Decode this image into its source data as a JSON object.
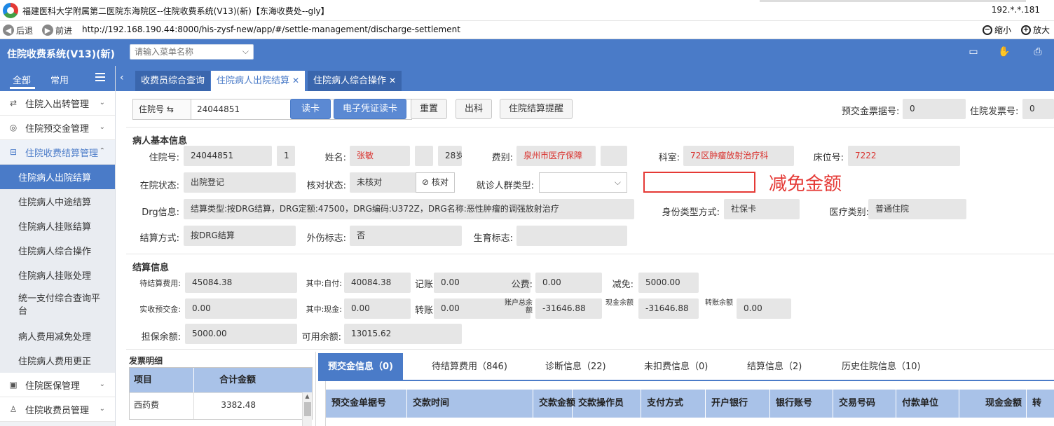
{
  "browser": {
    "title": "福建医科大学附属第二医院东海院区--住院收费系统(V13)(新)【东海收费处--gly】",
    "ip": "192.*.*.181",
    "back_label": "后退",
    "forward_label": "前进",
    "url": "http://192.168.190.44:8000/his-zysf-new/app/#/settle-management/discharge-settlement",
    "zoom_out_label": "缩小",
    "zoom_in_label": "放大"
  },
  "header": {
    "app_title": "住院收费系统(V13)(新)",
    "menu_search_placeholder": "请输入菜单名称",
    "icons": [
      "id-card-icon",
      "hand-icon",
      "print-icon"
    ]
  },
  "sidebar": {
    "tab_all": "全部",
    "tab_common": "常用",
    "groups_top": [
      {
        "label": "住院入出转管理",
        "icon": "transfer-icon"
      },
      {
        "label": "住院预交金管理",
        "icon": "deposit-icon"
      }
    ],
    "open_group": {
      "label": "住院收费结算管理",
      "icon": "settle-icon"
    },
    "items": [
      {
        "label": "住院病人出院结算",
        "active": true
      },
      {
        "label": "住院病人中途结算"
      },
      {
        "label": "住院病人挂账结算"
      },
      {
        "label": "住院病人综合操作"
      },
      {
        "label": "住院病人挂账处理"
      },
      {
        "label": "统一支付综合查询平台"
      },
      {
        "label": "病人费用减免处理"
      },
      {
        "label": "住院病人费用更正"
      }
    ],
    "groups_bottom": [
      {
        "label": "住院医保管理",
        "icon": "insurance-icon"
      },
      {
        "label": "住院收费员管理",
        "icon": "user-icon"
      }
    ]
  },
  "tabs": [
    {
      "label": "收费员综合查询"
    },
    {
      "label": "住院病人出院结算",
      "active": true
    },
    {
      "label": "住院病人综合操作"
    }
  ],
  "toolbar": {
    "inpatient_no_label": "住院号 ⇆",
    "inpatient_no_value": "24044851",
    "read_card": "读卡",
    "e_voucher": "电子凭证读卡",
    "reset": "重置",
    "discharge": "出科",
    "settle_reminder": "住院结算提醒",
    "deposit_receipt_label": "预交金票据号:",
    "deposit_receipt_value": "0",
    "invoice_no_label": "住院发票号:",
    "invoice_no_value": "0"
  },
  "patient": {
    "section_title": "病人基本信息",
    "inpatient_no_label": "住院号:",
    "inpatient_no": "24044851",
    "times": "1",
    "name_label": "姓名:",
    "name": "张敏",
    "gender": "",
    "age": "28岁",
    "fee_type_label": "费别:",
    "fee_type": "泉州市医疗保障",
    "dept_label": "科室:",
    "dept": "72区肿瘤放射治疗科",
    "bed_label": "床位号:",
    "bed": "7222",
    "status_label": "在院状态:",
    "status": "出院登记",
    "check_status_label": "核对状态:",
    "check_status": "未核对",
    "check_button": "核对",
    "population_label": "就诊人群类型:",
    "annotation_text": "减免金额",
    "drg_label": "Drg信息:",
    "drg_info": "结算类型:按DRG结算，DRG定额:47500，DRG编码:U372Z，DRG名称:恶性肿瘤的调强放射治疗",
    "id_type_label": "身份类型方式:",
    "id_type": "社保卡",
    "med_type_label": "医疗类别:",
    "med_type": "普通住院",
    "settle_method_label": "结算方式:",
    "settle_method": "按DRG结算",
    "injury_label": "外伤标志:",
    "injury": "否",
    "birth_label": "生育标志:",
    "birth": ""
  },
  "settle": {
    "section_title": "结算信息",
    "pending_label": "待结算费用:",
    "pending": "45084.38",
    "self_pay_label": "其中:自付:",
    "self_pay": "40084.38",
    "account_label": "记账",
    "account": "0.00",
    "public_label": "公费:",
    "public": "0.00",
    "reduce_label": "减免:",
    "reduce": "5000.00",
    "received_label": "实收预交金:",
    "received": "0.00",
    "cash_label": "其中:现金:",
    "cash": "0.00",
    "transfer_label": "转账",
    "transfer": "0.00",
    "acct_balance_label": "账户总余额",
    "acct_balance": "-31646.88",
    "cash_balance_label": "现金余额",
    "cash_balance": "-31646.88",
    "transfer_balance_label": "转账余额",
    "transfer_balance": "0.00",
    "guarantee_label": "担保余额:",
    "guarantee": "5000.00",
    "available_label": "可用余额:",
    "available": "13015.62"
  },
  "invoice": {
    "title": "发票明细",
    "col_item": "项目",
    "col_total": "合计金额",
    "rows": [
      {
        "item": "西药费",
        "total": "3382.48"
      }
    ]
  },
  "bottom_tabs": [
    {
      "label": "预交金信息（0)",
      "active": true
    },
    {
      "label": "待结算费用（846)"
    },
    {
      "label": "诊断信息（22)"
    },
    {
      "label": "未扣费信息（0)"
    },
    {
      "label": "结算信息（2)"
    },
    {
      "label": "历史住院信息（10)"
    }
  ],
  "deposit_grid_cols": [
    "预交金单据号",
    "交款时间",
    "交款金额",
    "交款操作员",
    "支付方式",
    "开户银行",
    "银行账号",
    "交易号码",
    "付款单位",
    "现金金额",
    "转"
  ]
}
